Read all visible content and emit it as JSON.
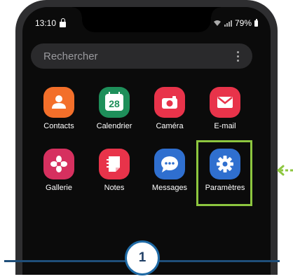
{
  "status_bar": {
    "time": "13:10",
    "battery": "79%"
  },
  "search": {
    "placeholder": "Rechercher"
  },
  "apps": [
    {
      "label": "Contacts",
      "icon": "contacts-icon",
      "color": "#f36f2a"
    },
    {
      "label": "Calendrier",
      "icon": "calendar-icon",
      "color": "#1e8f5a",
      "day": "28"
    },
    {
      "label": "Caméra",
      "icon": "camera-icon",
      "color": "#e8334a"
    },
    {
      "label": "E-mail",
      "icon": "email-icon",
      "color": "#e8334a"
    },
    {
      "label": "Gallerie",
      "icon": "gallery-icon",
      "color": "#d6305f"
    },
    {
      "label": "Notes",
      "icon": "notes-icon",
      "color": "#e8334a"
    },
    {
      "label": "Messages",
      "icon": "messages-icon",
      "color": "#2f6fcf"
    },
    {
      "label": "Paramètres",
      "icon": "settings-icon",
      "color": "#2f6fcf"
    }
  ],
  "highlight_color": "#8dc63f",
  "step": {
    "number": "1"
  }
}
